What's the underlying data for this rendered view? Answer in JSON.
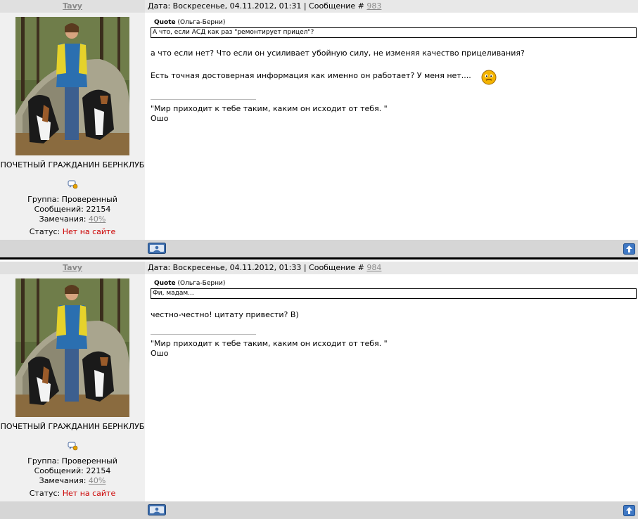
{
  "posts": [
    {
      "author": "Tavy",
      "header_text": "Дата: Воскресенье, 04.11.2012, 01:31 | Сообщение #",
      "post_number": "983",
      "rank": "ПОЧЕТНЫЙ ГРАЖДАНИН БЕРНКЛУБ",
      "group": "Группа: Проверенный",
      "messages": "Сообщений: 22154",
      "warnings_label": "Замечания:",
      "warnings_value": "40%",
      "status_label": "Статус:",
      "status_value": "Нет на сайте",
      "quote_label": "Quote",
      "quote_author": "(Ольга-Берни)",
      "quote_text": "А что, если АСД как раз \"ремонтирует прицел\"?",
      "body_lines": [
        "а что если нет? Что если он усиливает убойную силу, не изменяя качество прицеливания?",
        "Есть точная достоверная информация как именно он работает? У меня нет...."
      ],
      "signature_1": "\"Мир приходит к тебе таким, каким он исходит от тебя. \"",
      "signature_2": "Ошо"
    },
    {
      "author": "Tavy",
      "header_text": "Дата: Воскресенье, 04.11.2012, 01:33 | Сообщение #",
      "post_number": "984",
      "rank": "ПОЧЕТНЫЙ ГРАЖДАНИН БЕРНКЛУБ",
      "group": "Группа: Проверенный",
      "messages": "Сообщений: 22154",
      "warnings_label": "Замечания:",
      "warnings_value": "40%",
      "status_label": "Статус:",
      "status_value": "Нет на сайте",
      "quote_label": "Quote",
      "quote_author": "(Ольга-Берни)",
      "quote_text": "Фи, мадам...",
      "body_lines": [
        "честно-честно! цитату привести? B)"
      ],
      "signature_1": "\"Мир приходит к тебе таким, каким он исходит от тебя. \"",
      "signature_2": "Ошо"
    }
  ],
  "colors": {
    "header_bg": "#e8e8e8",
    "sidebar_bg": "#f0f0f0",
    "footer_bg": "#d6d6d6",
    "offline_red": "#cc0000",
    "link_gray": "#8a8a8a"
  },
  "icons": [
    "avatar-photo",
    "rank-icon",
    "smiley-icon",
    "profile-button-icon",
    "scroll-top-icon"
  ]
}
